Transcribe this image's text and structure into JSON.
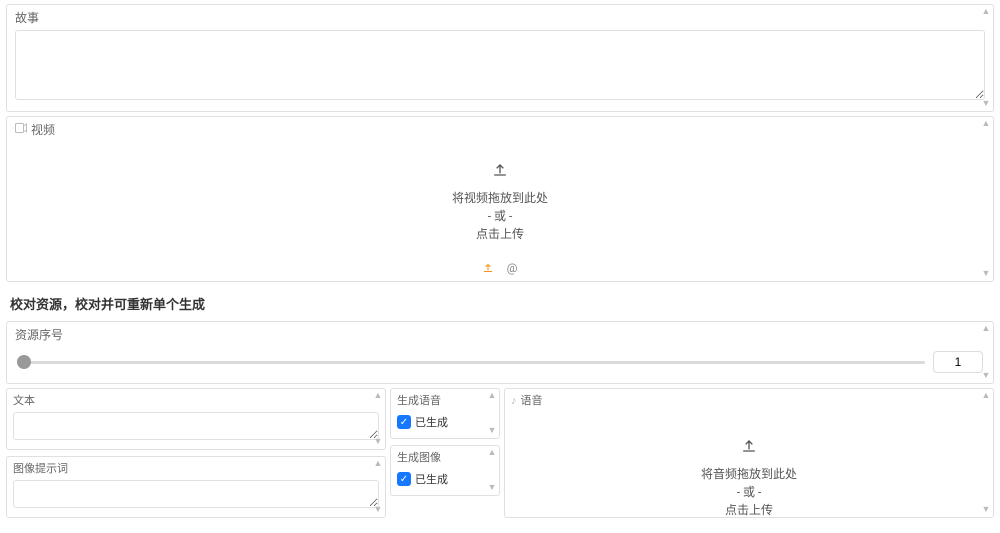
{
  "story": {
    "label": "故事",
    "value": ""
  },
  "video": {
    "label": "视频",
    "drop_line1": "将视频拖放到此处",
    "drop_or": "- 或 -",
    "drop_line2": "点击上传"
  },
  "section_title": "校对资源，校对并可重新单个生成",
  "resource_index": {
    "label": "资源序号",
    "value": "1"
  },
  "text_field": {
    "label": "文本",
    "value": ""
  },
  "prompt_field": {
    "label": "图像提示词",
    "value": ""
  },
  "gen_voice": {
    "label": "生成语音",
    "chk_label": "已生成"
  },
  "gen_image": {
    "label": "生成图像",
    "chk_label": "已生成"
  },
  "audio": {
    "label": "语音",
    "drop_line1": "将音频拖放到此处",
    "drop_or": "- 或 -",
    "drop_line2": "点击上传"
  }
}
